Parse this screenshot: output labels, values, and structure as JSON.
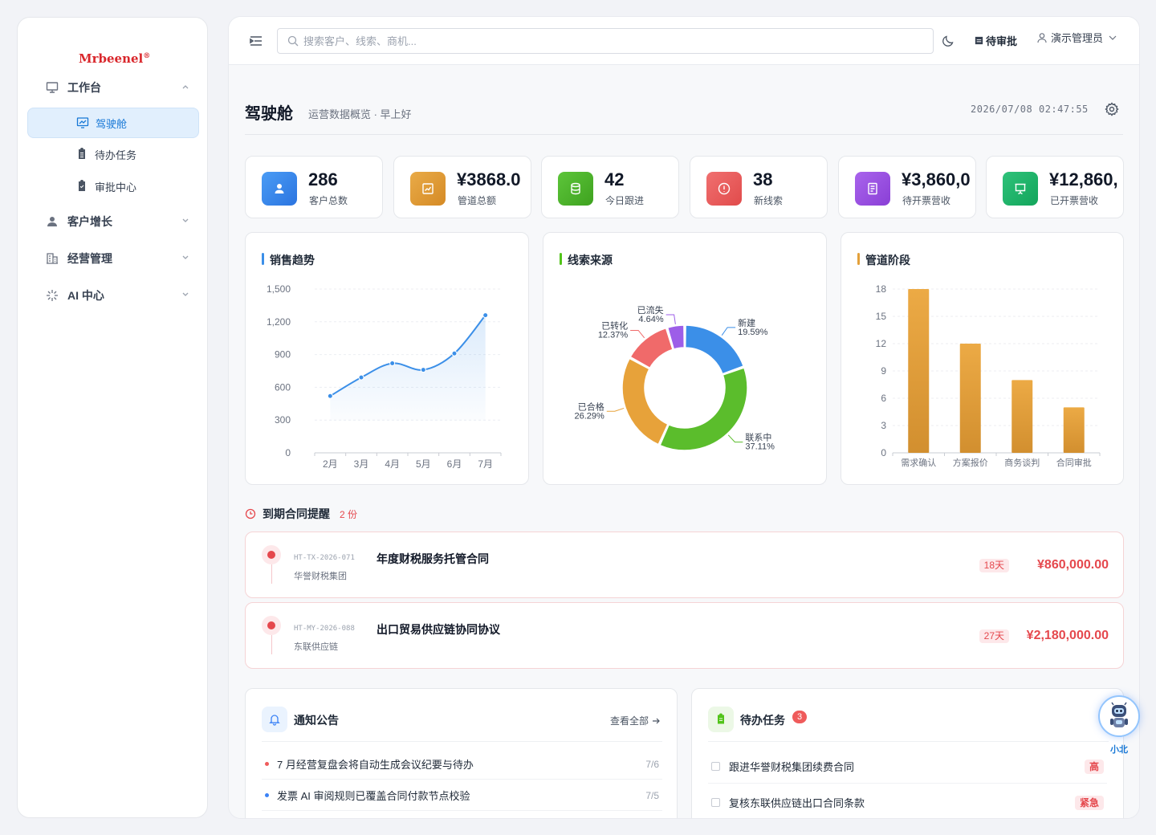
{
  "brand": {
    "name": "Mrbeenel",
    "reg": "®"
  },
  "sidebar": {
    "groups": [
      {
        "label": "工作台"
      },
      {
        "label": "客户增长"
      },
      {
        "label": "经营管理"
      },
      {
        "label": "AI 中心"
      }
    ],
    "subitems": [
      {
        "label": "驾驶舱"
      },
      {
        "label": "待办任务"
      },
      {
        "label": "审批中心"
      }
    ]
  },
  "topbar": {
    "search_placeholder": "搜索客户、线索、商机...",
    "pending_label": "待审批",
    "user_name": "演示管理员"
  },
  "page": {
    "title": "驾驶舱",
    "subtitle": "运营数据概览 · 早上好",
    "datetime": "2026/07/08 02:47:55"
  },
  "kpis": [
    {
      "value": "286",
      "label": "客户总数",
      "color": "#3b82f6"
    },
    {
      "value": "¥3868.0",
      "label": "管道总额",
      "color": "#e3a03a"
    },
    {
      "value": "42",
      "label": "今日跟进",
      "color": "#52c41a"
    },
    {
      "value": "38",
      "label": "新线索",
      "color": "#ef5b5b"
    },
    {
      "value": "¥3,860,0",
      "label": "待开票营收",
      "color": "#9b51e0"
    },
    {
      "value": "¥12,860,",
      "label": "已开票营收",
      "color": "#16b364"
    }
  ],
  "cards": {
    "sales_title": "销售趋势",
    "source_title": "线索来源",
    "stage_title": "管道阶段"
  },
  "chart_data": [
    {
      "type": "area",
      "title": "销售趋势",
      "categories": [
        "2月",
        "3月",
        "4月",
        "5月",
        "6月",
        "7月"
      ],
      "values": [
        520,
        690,
        820,
        760,
        910,
        1260
      ],
      "yticks": [
        "0",
        "300",
        "600",
        "900",
        "1,200",
        "1,500"
      ],
      "ylim": [
        0,
        1500
      ],
      "color": "#3b8fe8",
      "grid": true
    },
    {
      "type": "pie",
      "title": "线索来源",
      "donut": true,
      "slices": [
        {
          "name": "新建",
          "percent": 19.59,
          "label": "19.59%",
          "color": "#3b8fe8"
        },
        {
          "name": "联系中",
          "percent": 37.11,
          "label": "37.11%",
          "color": "#5bbd2c"
        },
        {
          "name": "已合格",
          "percent": 26.29,
          "label": "26.29%",
          "color": "#e7a23a"
        },
        {
          "name": "已转化",
          "percent": 12.37,
          "label": "12.37%",
          "color": "#f06a6a"
        },
        {
          "name": "已流失",
          "percent": 4.64,
          "label": "4.64%",
          "color": "#9d5ee8"
        }
      ]
    },
    {
      "type": "bar",
      "title": "管道阶段",
      "categories": [
        "需求确认",
        "方案报价",
        "商务谈判",
        "合同审批"
      ],
      "values": [
        18,
        12,
        8,
        5
      ],
      "yticks": [
        "0",
        "3",
        "6",
        "9",
        "12",
        "15",
        "18"
      ],
      "ylim": [
        0,
        18
      ],
      "color": "#e3a03a",
      "grid": true
    }
  ],
  "expiry": {
    "title": "到期合同提醒",
    "count": "2 份",
    "items": [
      {
        "code": "HT-TX-2026-071",
        "name": "年度财税服务托管合同",
        "company": "华誉财税集团",
        "days": "18天",
        "amount": "¥860,000.00"
      },
      {
        "code": "HT-MY-2026-088",
        "name": "出口贸易供应链协同协议",
        "company": "东联供应链",
        "days": "27天",
        "amount": "¥2,180,000.00"
      }
    ]
  },
  "notice": {
    "title": "通知公告",
    "view_all": "查看全部",
    "items": [
      {
        "text": "7 月经营复盘会将自动生成会议纪要与待办",
        "date": "7/6",
        "color": "#ef5b5b"
      },
      {
        "text": "发票 AI 审阅规则已覆盖合同付款节点校验",
        "date": "7/5",
        "color": "#3b82f6"
      }
    ]
  },
  "todo": {
    "title": "待办任务",
    "count": "3",
    "items": [
      {
        "text": "跟进华誉财税集团续费合同",
        "priority": "高"
      },
      {
        "text": "复核东联供应链出口合同条款",
        "priority": "紧急"
      }
    ]
  },
  "assistant": {
    "label": "小北"
  }
}
